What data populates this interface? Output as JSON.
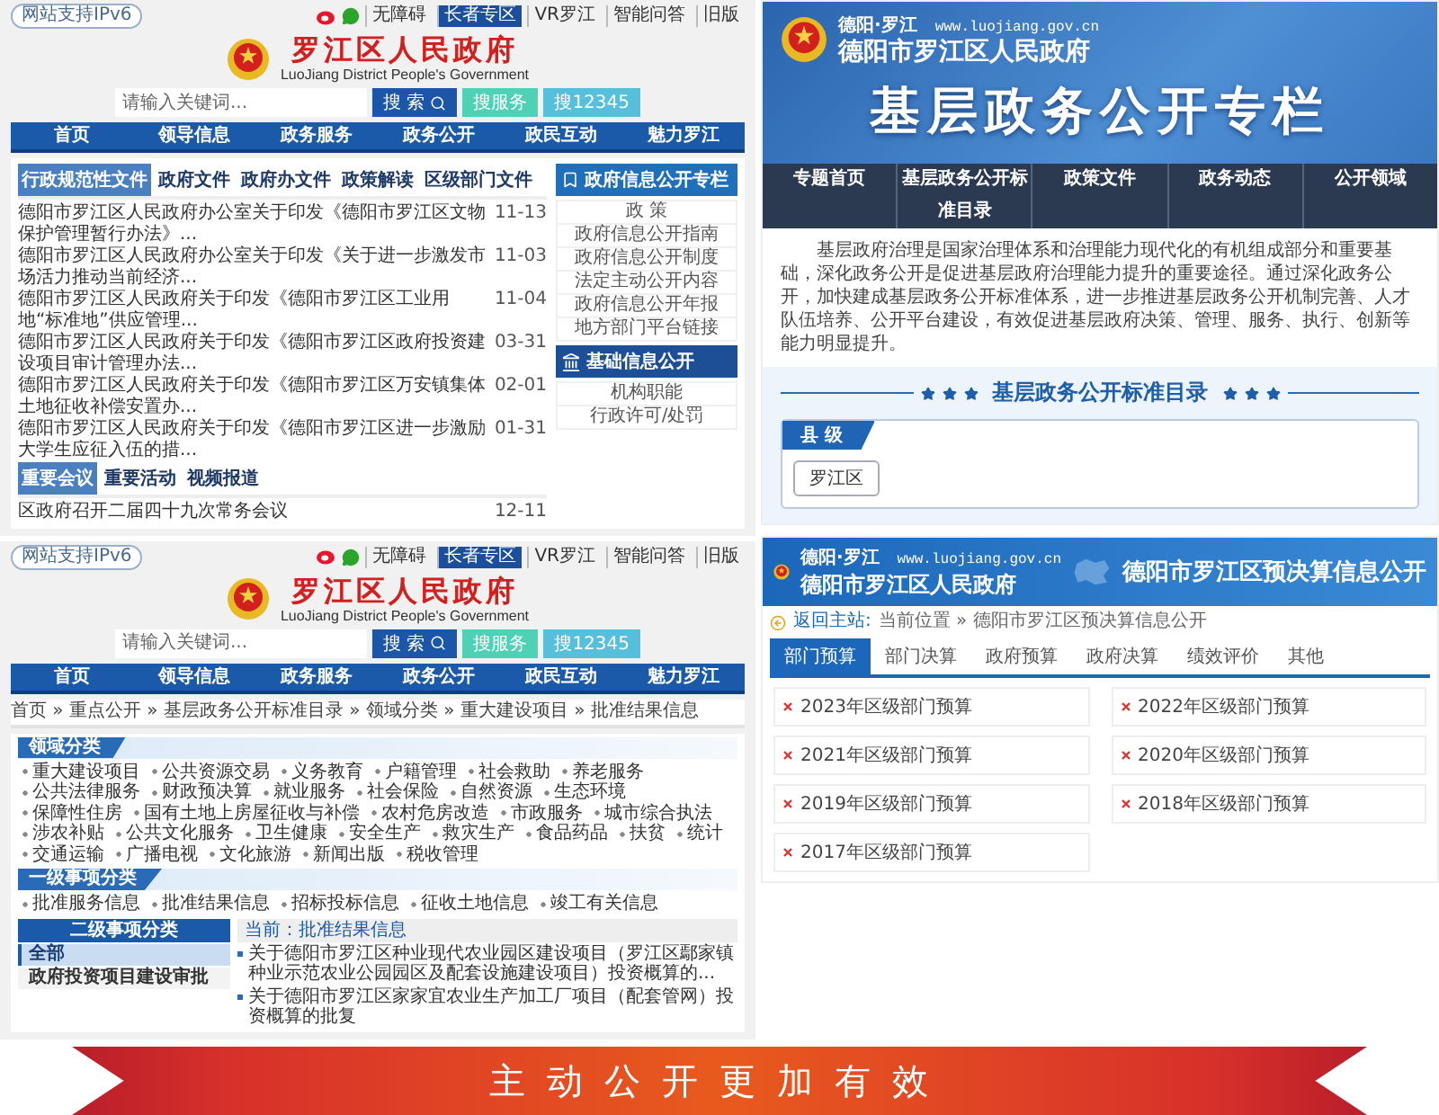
{
  "portal_home": {
    "ipv6_badge": "网站支持IPv6",
    "top_links": [
      {
        "label": "无障碍",
        "highlighted": false
      },
      {
        "label": "长者专区",
        "highlighted": true
      },
      {
        "label": "VR罗江",
        "highlighted": false
      },
      {
        "label": "智能问答",
        "highlighted": false
      },
      {
        "label": "旧版",
        "highlighted": false
      }
    ],
    "site_title": "罗江区人民政府",
    "site_subtitle": "LuoJiang District People's Government",
    "search": {
      "placeholder": "请输入关键词...",
      "button": "搜 索",
      "extra_buttons": [
        "搜服务",
        "搜12345"
      ]
    },
    "nav": [
      "首页",
      "领导信息",
      "政务服务",
      "政务公开",
      "政民互动",
      "魅力罗江"
    ],
    "doc_tabs": [
      {
        "label": "行政规范性文件",
        "selected": true
      },
      {
        "label": "政府文件",
        "selected": false
      },
      {
        "label": "政府办文件",
        "selected": false
      },
      {
        "label": "政策解读",
        "selected": false
      },
      {
        "label": "区级部门文件",
        "selected": false
      }
    ],
    "documents": [
      {
        "title": "德阳市罗江区人民政府办公室关于印发《德阳市罗江区文物保护管理暂行办法》...",
        "date": "11-13"
      },
      {
        "title": "德阳市罗江区人民政府办公室关于印发《关于进一步激发市场活力推动当前经济...",
        "date": "11-03"
      },
      {
        "title": "德阳市罗江区人民政府关于印发《德阳市罗江区工业用地“标准地”供应管理...",
        "date": "11-04"
      },
      {
        "title": "德阳市罗江区人民政府关于印发《德阳市罗江区政府投资建设项目审计管理办法...",
        "date": "03-31"
      },
      {
        "title": "德阳市罗江区人民政府关于印发《德阳市罗江区万安镇集体土地征收补偿安置办...",
        "date": "02-01"
      },
      {
        "title": "德阳市罗江区人民政府关于印发《德阳市罗江区进一步激励大学生应征入伍的措...",
        "date": "01-31"
      }
    ],
    "meeting_tabs": [
      {
        "label": "重要会议",
        "selected": true
      },
      {
        "label": "重要活动",
        "selected": false
      },
      {
        "label": "视频报道",
        "selected": false
      }
    ],
    "meetings": [
      {
        "title": "区政府召开二届四十九次常务会议",
        "date": "12-11"
      }
    ],
    "open_column": {
      "title": "政府信息公开专栏",
      "links": [
        "政 策",
        "政府信息公开指南",
        "政府信息公开制度",
        "法定主动公开内容",
        "政府信息公开年报",
        "地方部门平台链接"
      ]
    },
    "basic_info": {
      "title": "基础信息公开",
      "links": [
        "机构职能",
        "行政许可/处罚"
      ]
    }
  },
  "open_column_page": {
    "region_tag": "德阳·罗江",
    "url": "www.luojiang.gov.cn",
    "site_name": "德阳市罗江区人民政府",
    "title": "基层政务公开专栏",
    "nav": [
      "专题首页",
      "基层政务公开标准目录",
      "政策文件",
      "政务动态",
      "公开领域"
    ],
    "intro": "基层政府治理是国家治理体系和治理能力现代化的有机组成部分和重要基础，深化政务公开是促进基层政府治理能力提升的重要途径。通过深化政务公开，加快建成基层政务公开标准体系，进一步推进基层政务公开机制完善、人才队伍培养、公开平台建设，有效促进基层政府决策、管理、服务、执行、创新等能力明显提升。",
    "catalog_title": "基层政务公开标准目录",
    "level_tab": "县 级",
    "regions": [
      "罗江区"
    ]
  },
  "portal_category": {
    "ipv6_badge": "网站支持IPv6",
    "top_links": [
      {
        "label": "无障碍",
        "highlighted": false
      },
      {
        "label": "长者专区",
        "highlighted": true
      },
      {
        "label": "VR罗江",
        "highlighted": false
      },
      {
        "label": "智能问答",
        "highlighted": false
      },
      {
        "label": "旧版",
        "highlighted": false
      }
    ],
    "site_title": "罗江区人民政府",
    "site_subtitle": "LuoJiang District People's Government",
    "search": {
      "placeholder": "请输入关键词...",
      "button": "搜 索",
      "extra_buttons": [
        "搜服务",
        "搜12345"
      ]
    },
    "nav": [
      "首页",
      "领导信息",
      "政务服务",
      "政务公开",
      "政民互动",
      "魅力罗江"
    ],
    "breadcrumb": "首页 » 重点公开 » 基层政务公开标准目录 » 领域分类 » 重大建设项目 » 批准结果信息",
    "groups": [
      {
        "title": "领域分类",
        "items": [
          "重大建设项目",
          "公共资源交易",
          "义务教育",
          "户籍管理",
          "社会救助",
          "养老服务",
          "公共法律服务",
          "财政预决算",
          "就业服务",
          "社会保险",
          "自然资源",
          "生态环境",
          "保障性住房",
          "国有土地上房屋征收与补偿",
          "农村危房改造",
          "市政服务",
          "城市综合执法",
          "涉农补贴",
          "公共文化服务",
          "卫生健康",
          "安全生产",
          "救灾生产",
          "食品药品",
          "扶贫",
          "统计",
          "交通运输",
          "广播电视",
          "文化旅游",
          "新闻出版",
          "税收管理"
        ]
      },
      {
        "title": "一级事项分类",
        "items": [
          "批准服务信息",
          "批准结果信息",
          "招标投标信息",
          "征收土地信息",
          "竣工有关信息"
        ]
      }
    ],
    "sidebar": {
      "title": "二级事项分类",
      "items": [
        {
          "label": "全部",
          "selected": true
        },
        {
          "label": "政府投资项目建设审批",
          "selected": false
        }
      ]
    },
    "current": "当前：批准结果信息",
    "results": [
      "关于德阳市罗江区种业现代农业园区建设项目（罗江区鄢家镇种业示范农业公园园区及配套设施建设项目）投资概算的...",
      "关于德阳市罗江区家家宜农业生产加工厂项目（配套管网）投资概算的批复"
    ]
  },
  "budget_page": {
    "region_tag": "德阳·罗江",
    "url": "www.luojiang.gov.cn",
    "site_name": "德阳市罗江区人民政府",
    "title": "德阳市罗江区预决算信息公开",
    "back_link": "返回主站:",
    "location": "当前位置 » 德阳市罗江区预决算信息公开",
    "tabs": [
      {
        "label": "部门预算",
        "selected": true
      },
      {
        "label": "部门决算",
        "selected": false
      },
      {
        "label": "政府预算",
        "selected": false
      },
      {
        "label": "政府决算",
        "selected": false
      },
      {
        "label": "绩效评价",
        "selected": false
      },
      {
        "label": "其他",
        "selected": false
      }
    ],
    "items": [
      "2023年区级部门预算",
      "2022年区级部门预算",
      "2021年区级部门预算",
      "2020年区级部门预算",
      "2019年区级部门预算",
      "2018年区级部门预算",
      "2017年区级部门预算"
    ]
  },
  "banner": {
    "slogan": "主动公开更加有效"
  }
}
